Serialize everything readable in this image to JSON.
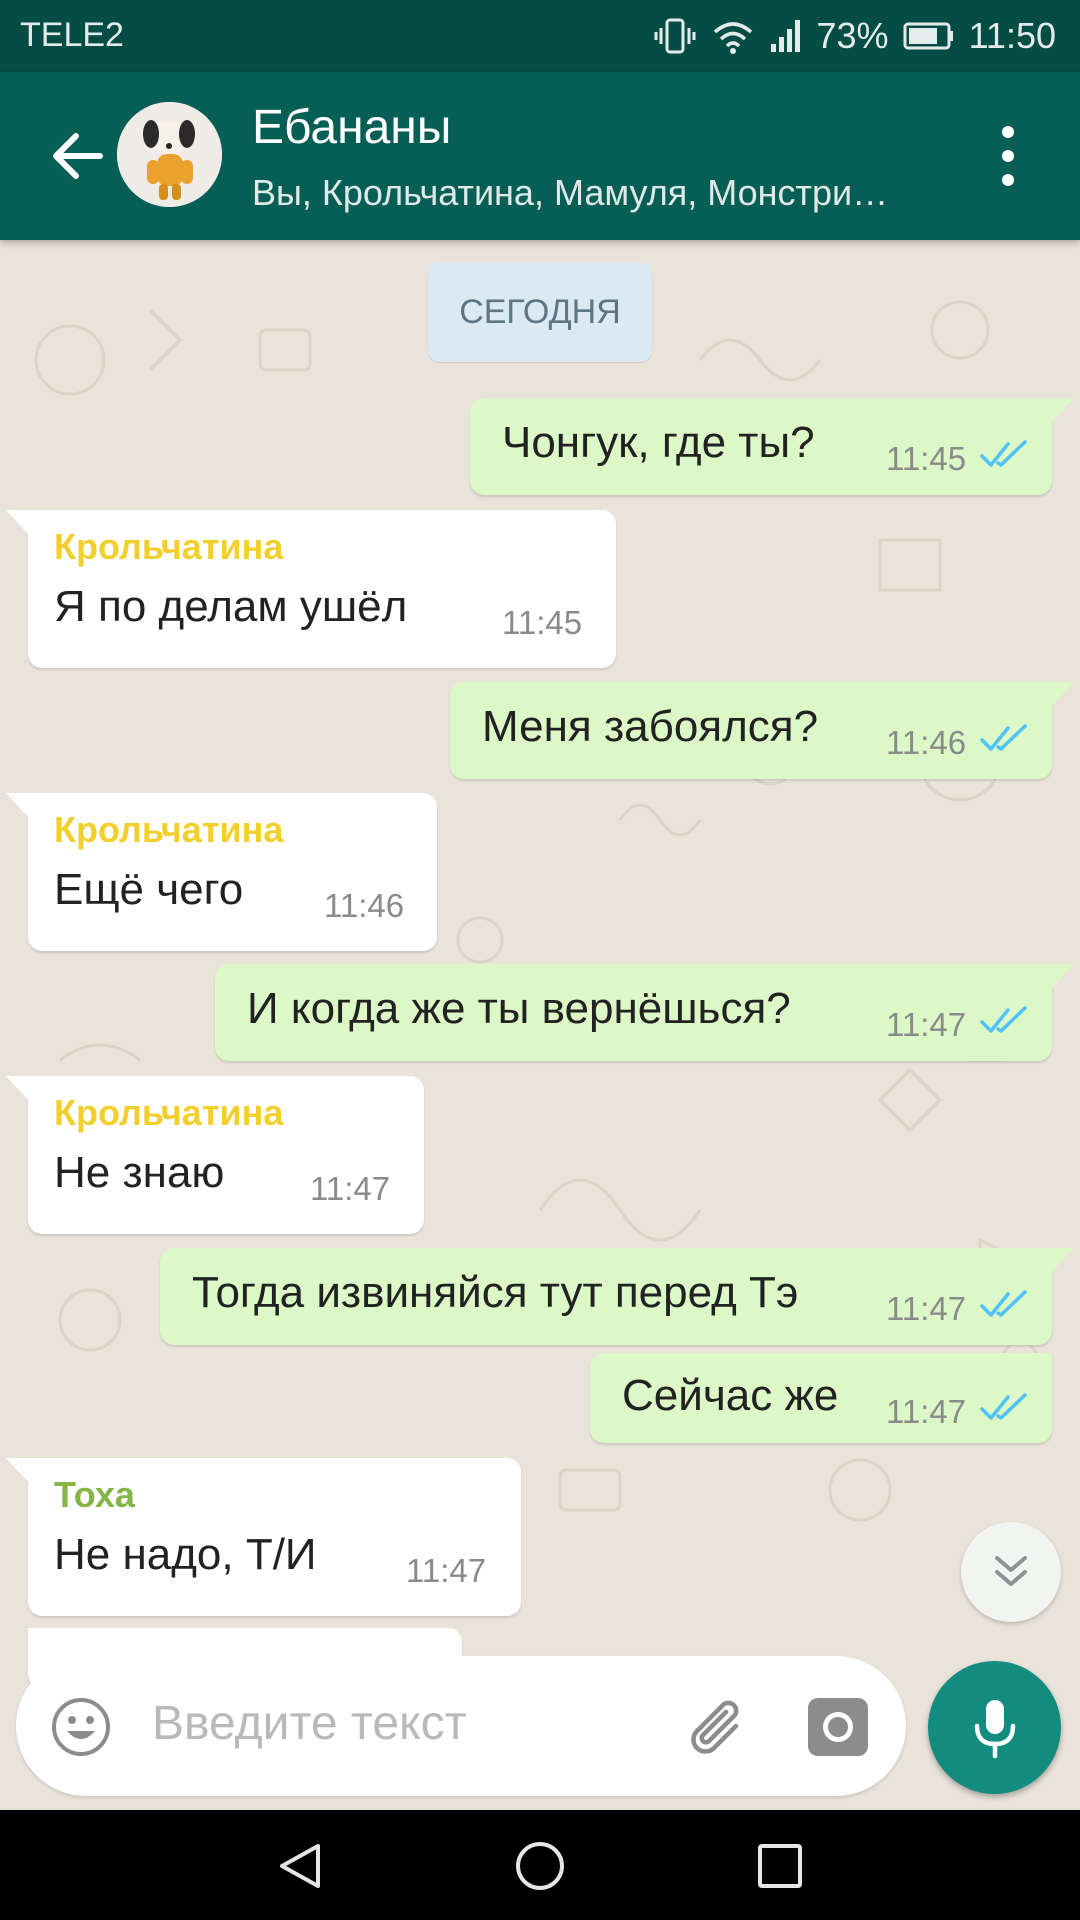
{
  "status_bar": {
    "carrier": "TELE2",
    "battery": "73%",
    "time": "11:50"
  },
  "header": {
    "title": "Ебананы",
    "subtitle": "Вы, Крольчатина, Мамуля, Монстри…"
  },
  "chat": {
    "date_label": "СЕГОДНЯ",
    "messages": [
      {
        "direction": "out",
        "text": "Чонгук, где ты?",
        "time": "11:45",
        "status": "read"
      },
      {
        "direction": "in",
        "sender": "Крольчатина",
        "sender_color": "#f2cf2b",
        "text": "Я по делам ушёл",
        "time": "11:45"
      },
      {
        "direction": "out",
        "text": "Меня забоялся?",
        "time": "11:46",
        "status": "read"
      },
      {
        "direction": "in",
        "sender": "Крольчатина",
        "sender_color": "#f2cf2b",
        "text": "Ещё чего",
        "time": "11:46"
      },
      {
        "direction": "out",
        "text": "И когда же ты вернёшься?",
        "time": "11:47",
        "status": "read"
      },
      {
        "direction": "in",
        "sender": "Крольчатина",
        "sender_color": "#f2cf2b",
        "text": "Не знаю",
        "time": "11:47"
      },
      {
        "direction": "out",
        "text": "Тогда извиняйся тут перед Тэ",
        "time": "11:47",
        "status": "read"
      },
      {
        "direction": "out",
        "text": "Сейчас же",
        "time": "11:47",
        "status": "read"
      },
      {
        "direction": "in",
        "sender": "Тоха",
        "sender_color": "#86b547",
        "text": "Не надо, Т/И",
        "time": "11:47"
      }
    ]
  },
  "input": {
    "placeholder": "Введите текст"
  },
  "colors": {
    "header": "#075e54",
    "status_bar": "#054c45",
    "outgoing_bubble": "#dcf8c6",
    "incoming_bubble": "#ffffff",
    "read_ticks": "#4fc3f7",
    "mic_button": "#128c7e"
  },
  "icons": {
    "back": "arrow-left-icon",
    "menu": "more-vert-icon",
    "read_status": "double-check-icon",
    "scroll_down": "double-chevron-down-icon",
    "emoji": "smiley-icon",
    "attach": "paperclip-icon",
    "camera": "camera-icon",
    "mic": "microphone-icon"
  }
}
